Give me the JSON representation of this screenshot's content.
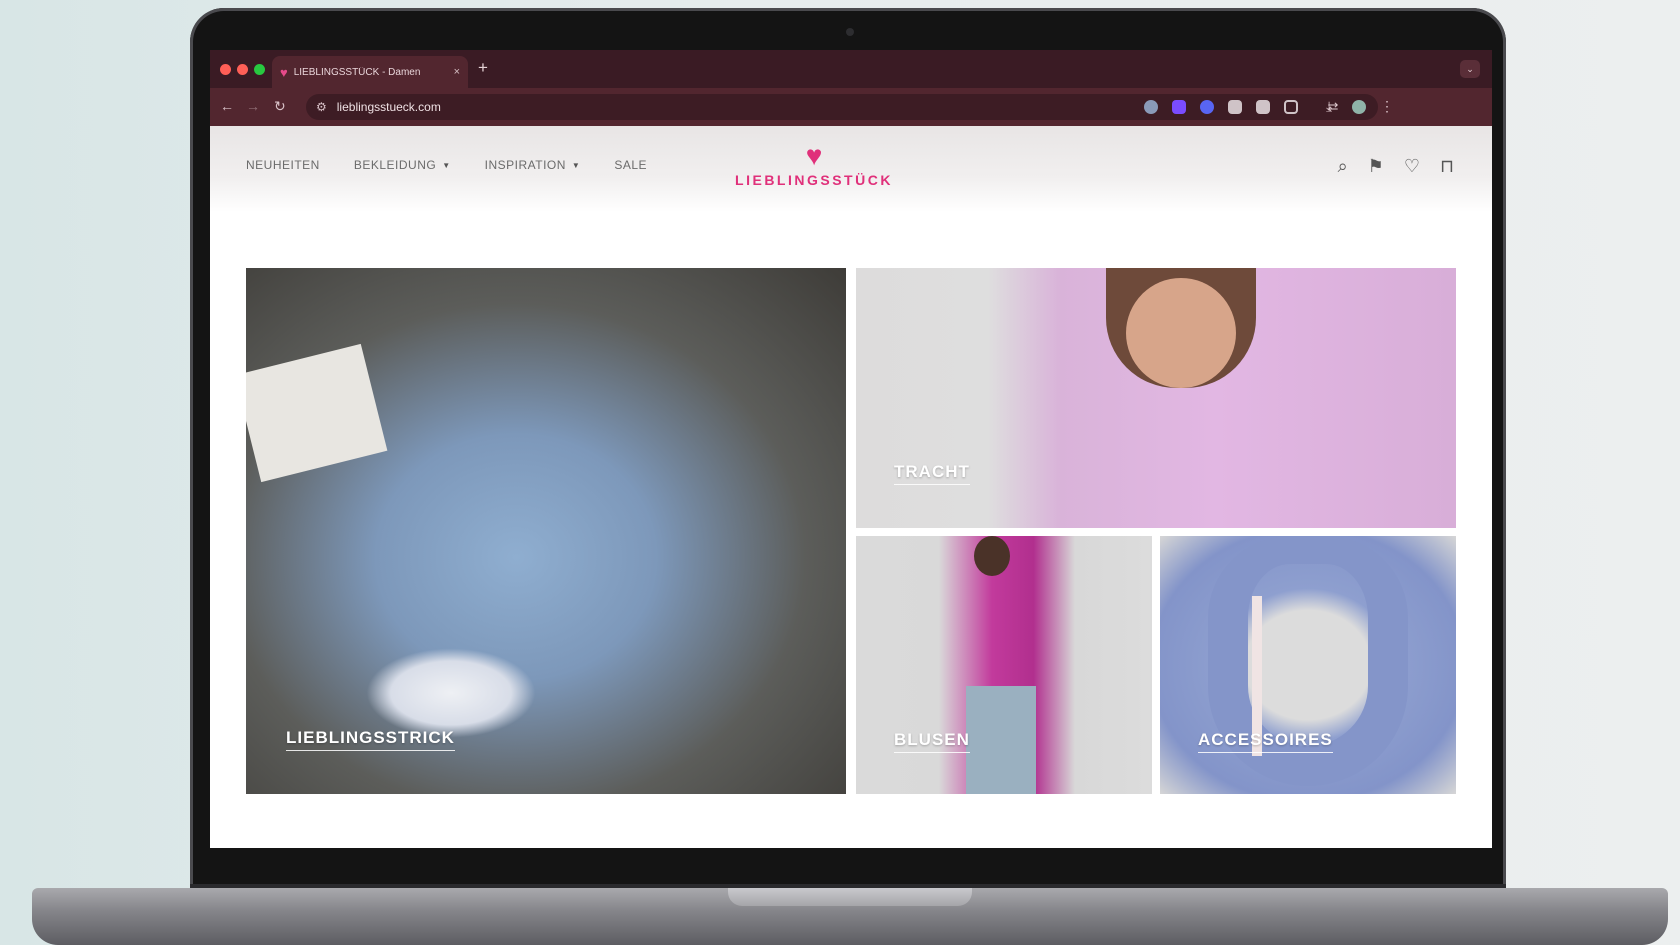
{
  "browser": {
    "tab_title": "LIEBLINGSSTÜCK - Damen",
    "tab_close": "×",
    "new_tab": "+",
    "url": "lieblingsstueck.com",
    "traffic_colors": [
      "#ff5f57",
      "#ff5f57",
      "#28c840"
    ]
  },
  "site": {
    "brand": "LIEBLINGSSTÜCK",
    "brand_color": "#e0307a",
    "menu": [
      {
        "label": "NEUHEITEN",
        "dropdown": false
      },
      {
        "label": "BEKLEIDUNG",
        "dropdown": true
      },
      {
        "label": "INSPIRATION",
        "dropdown": true
      },
      {
        "label": "SALE",
        "dropdown": false
      }
    ],
    "icons": [
      "search-icon",
      "bookmark-icon",
      "heart-icon",
      "bag-icon"
    ]
  },
  "tiles": [
    {
      "label": "LIEBLINGSSTRICK"
    },
    {
      "label": "TRACHT"
    },
    {
      "label": "BLUSEN"
    },
    {
      "label": "ACCESSOIRES"
    }
  ]
}
